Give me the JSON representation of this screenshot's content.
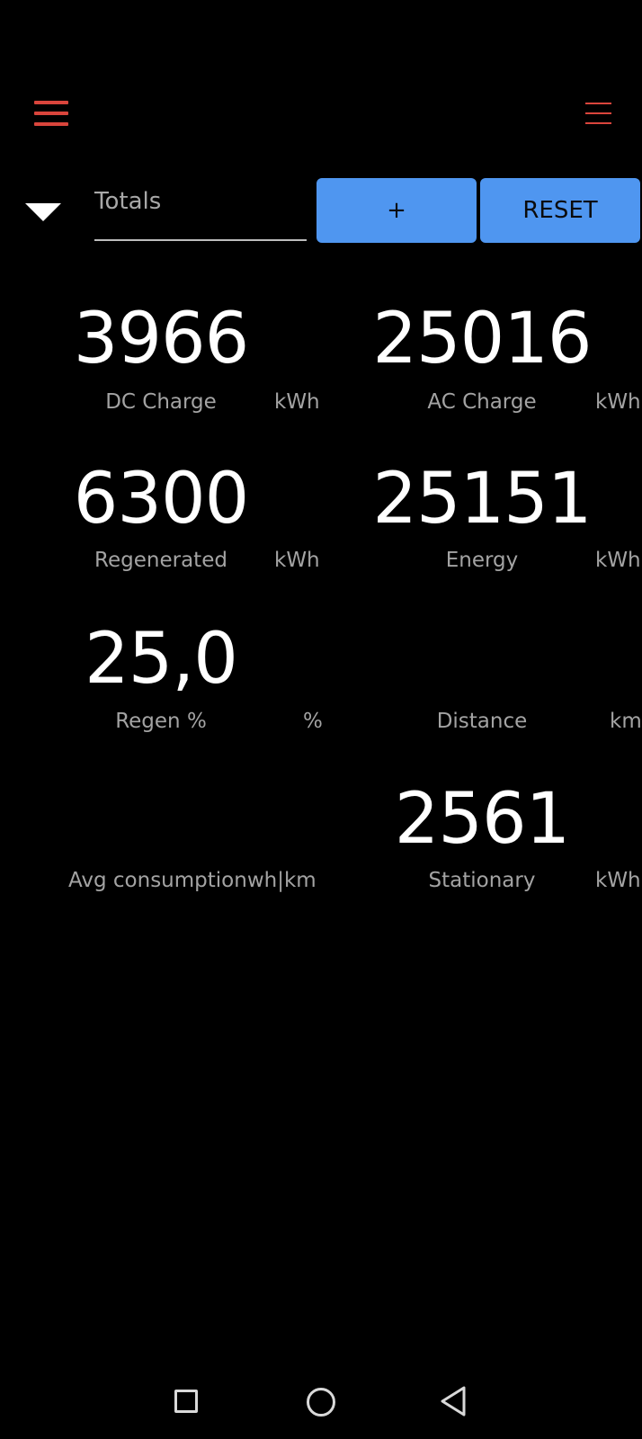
{
  "colors": {
    "accent": "#d9453c",
    "button": "#4f96f0",
    "background": "#000000"
  },
  "header": {
    "left_icon": "hamburger-menu-icon",
    "right_icon": "overflow-menu-icon"
  },
  "controls": {
    "dropdown_icon": "caret-down-icon",
    "selected_period": "Totals",
    "add_label": "+",
    "reset_label": "RESET"
  },
  "metrics": {
    "dc_charge": {
      "value": "3966",
      "label": "DC Charge",
      "unit": "kWh"
    },
    "ac_charge": {
      "value": "25016",
      "label": "AC Charge",
      "unit": "kWh"
    },
    "regenerated": {
      "value": "6300",
      "label": "Regenerated",
      "unit": "kWh"
    },
    "energy": {
      "value": "25151",
      "label": "Energy",
      "unit": "kWh"
    },
    "regen_pct": {
      "value": "25,0",
      "label": "Regen %",
      "unit": "%"
    },
    "distance": {
      "value": "",
      "label": "Distance",
      "unit": "km"
    },
    "avg_consumption": {
      "value": "",
      "label": "Avg consumption",
      "unit": "wh|km"
    },
    "stationary": {
      "value": "2561",
      "label": "Stationary",
      "unit": "kWh"
    }
  },
  "navbar": {
    "recents_icon": "square-recents-icon",
    "home_icon": "circle-home-icon",
    "back_icon": "triangle-back-icon"
  }
}
